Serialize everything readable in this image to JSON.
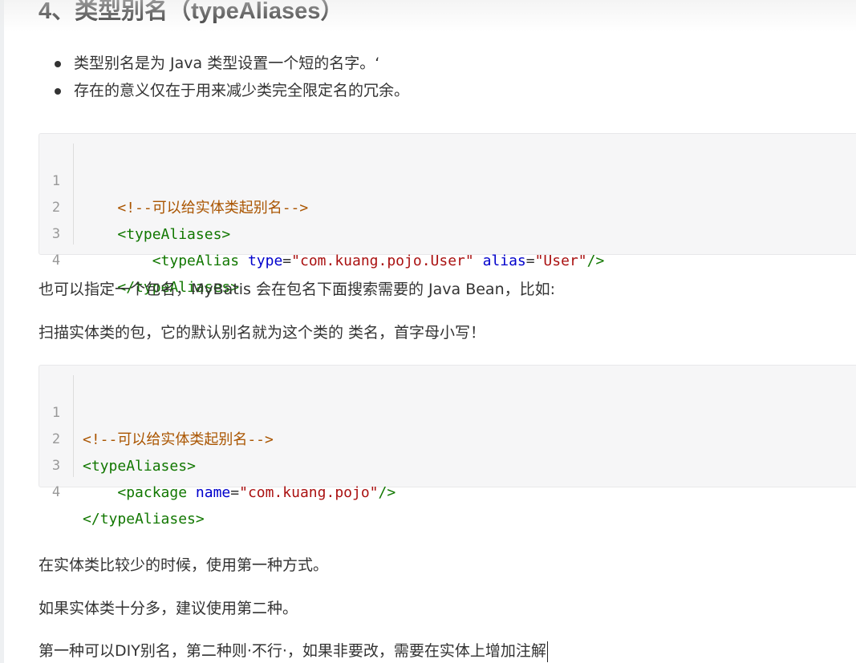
{
  "heading": "4、类型别名（typeAliases）",
  "bullets": [
    "类型别名是为 Java 类型设置一个短的名字。‘",
    "存在的意义仅在于用来减少类完全限定名的冗余。"
  ],
  "code1": {
    "line_numbers": [
      "1",
      "2",
      "3",
      "4"
    ],
    "lines": [
      {
        "indent": "    ",
        "comment": "<!--可以给实体类起别名-->"
      },
      {
        "indent": "    ",
        "open": "<",
        "tag": "typeAliases",
        "close": ">"
      },
      {
        "indent": "        ",
        "open": "<",
        "tag": "typeAlias",
        "sp1": " ",
        "attr1": "type",
        "eq1": "=",
        "val1": "\"com.kuang.pojo.User\"",
        "sp2": " ",
        "attr2": "alias",
        "eq2": "=",
        "val2": "\"User\"",
        "close": "/>"
      },
      {
        "indent": "    ",
        "open": "</",
        "tag": "typeAliases",
        "close": ">"
      }
    ]
  },
  "para1": "也可以指定一个包名，MyBatis 会在包名下面搜索需要的 Java Bean，比如:",
  "para2": "扫描实体类的包，它的默认别名就为这个类的 类名，首字母小写！",
  "code2": {
    "line_numbers": [
      "1",
      "2",
      "3",
      "4"
    ],
    "lines": [
      {
        "indent": "",
        "comment": "<!--可以给实体类起别名-->"
      },
      {
        "indent": "",
        "open": "<",
        "tag": "typeAliases",
        "close": ">"
      },
      {
        "indent": "    ",
        "open": "<",
        "tag": "package",
        "sp1": " ",
        "attr1": "name",
        "eq1": "=",
        "val1": "\"com.kuang.pojo\"",
        "close": "/>"
      },
      {
        "indent": "",
        "open": "</",
        "tag": "typeAliases",
        "close": ">"
      }
    ]
  },
  "para3": "在实体类比较少的时候，使用第一种方式。",
  "para4": "如果实体类十分多，建议使用第二种。",
  "para5": "第一种可以DIY别名，第二种则·不行·，如果非要改，需要在实体上增加注解",
  "colors": {
    "comment": "#aa5500",
    "tag": "#117700",
    "attribute": "#0000cc",
    "string": "#aa1111",
    "code_background": "#f6f6f7"
  }
}
